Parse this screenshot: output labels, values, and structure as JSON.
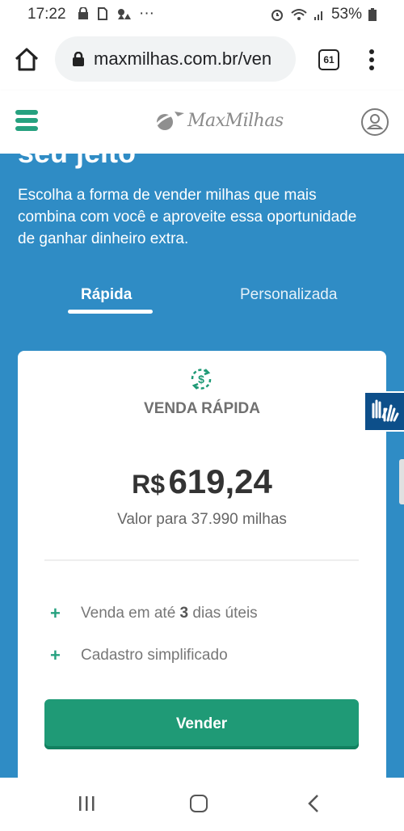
{
  "status_bar": {
    "time": "17:22",
    "dots": "···",
    "battery": "53%"
  },
  "browser": {
    "url": "maxmilhas.com.br/ven",
    "tab_count": "61"
  },
  "site": {
    "logo_text": "MaxMilhas"
  },
  "hero": {
    "cut_title": "seu jeito",
    "description": "Escolha a forma de vender milhas que mais combina com você e aproveite essa oportunidade de ganhar dinheiro extra."
  },
  "tabs": [
    {
      "label": "Rápida",
      "active": true
    },
    {
      "label": "Personalizada",
      "active": false
    }
  ],
  "card": {
    "title": "VENDA RÁPIDA",
    "currency": "R$",
    "amount": "619,24",
    "subtitle": "Valor para 37.990 milhas",
    "features": [
      {
        "prefix": "Venda em até ",
        "bold": "3",
        "suffix": " dias úteis"
      },
      {
        "text": "Cadastro simplificado"
      }
    ],
    "button_label": "Vender"
  },
  "colors": {
    "hero_blue": "#2f8cc5",
    "accent_green": "#1f9a76",
    "a11y_blue": "#0d4f8a"
  },
  "icons": [
    "home-icon",
    "lock-icon",
    "kebab-menu-icon",
    "hamburger-menu-icon",
    "user-icon",
    "money-cycle-icon",
    "accessibility-hands-icon",
    "recents-icon",
    "home-nav-icon",
    "back-icon"
  ]
}
